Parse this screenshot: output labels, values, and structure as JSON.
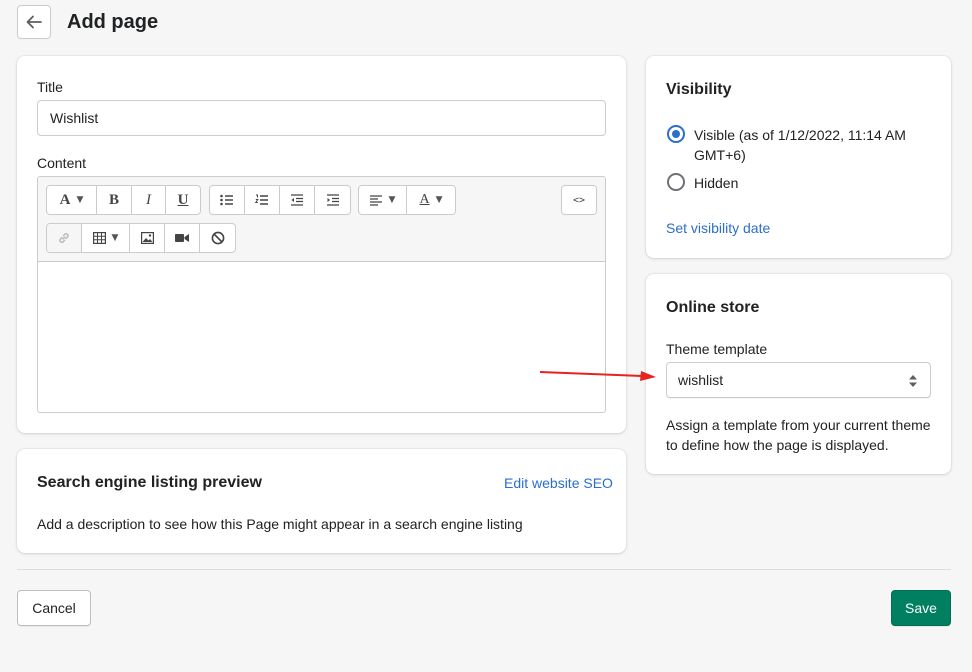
{
  "header": {
    "title": "Add page",
    "back_icon": "arrow-left-icon"
  },
  "page_form": {
    "title_label": "Title",
    "title_value": "Wishlist",
    "content_label": "Content",
    "toolbar": {
      "font_glyph": "A",
      "bold_glyph": "B",
      "italic_glyph": "I",
      "underline_glyph": "U",
      "text_color_glyph": "A",
      "html_glyph": "<>"
    }
  },
  "seo": {
    "title": "Search engine listing preview",
    "edit_link": "Edit website SEO",
    "description": "Add a description to see how this Page might appear in a search engine listing"
  },
  "visibility": {
    "title": "Visibility",
    "options": [
      {
        "label": "Visible (as of 1/12/2022, 11:14 AM GMT+6)",
        "checked": true
      },
      {
        "label": "Hidden",
        "checked": false
      }
    ],
    "set_date_link": "Set visibility date"
  },
  "online_store": {
    "title": "Online store",
    "template_label": "Theme template",
    "template_value": "wishlist",
    "help_text": "Assign a template from your current theme to define how the page is displayed."
  },
  "footer": {
    "cancel_label": "Cancel",
    "save_label": "Save"
  },
  "colors": {
    "primary": "#008060",
    "link": "#2c6ecb",
    "annotation_arrow": "#e8221f"
  }
}
